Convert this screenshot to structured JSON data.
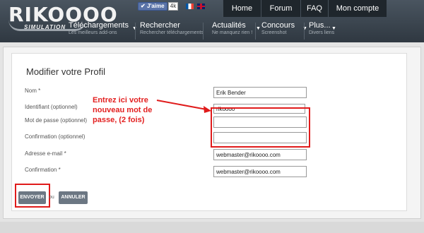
{
  "header": {
    "logo_text": "RIKOOOO",
    "logo_sub": "SIMULATION",
    "like_label": "J'aime",
    "like_count": "4k",
    "top_nav": [
      "Home",
      "Forum",
      "FAQ",
      "Mon compte"
    ],
    "main_nav": [
      {
        "title": "Téléchargements",
        "sub": "Les meilleurs add-ons"
      },
      {
        "title": "Rechercher",
        "sub": "Rechercher téléchargements"
      },
      {
        "title": "Actualités",
        "sub": "Ne manquez rien !"
      },
      {
        "title": "Concours",
        "sub": "Screenshot"
      },
      {
        "title": "Plus...",
        "sub": "Divers liens"
      }
    ]
  },
  "form": {
    "title": "Modifier votre Profil",
    "labels": {
      "name": "Nom *",
      "identifier": "Identifiant (optionnel)",
      "password": "Mot de passe (optionnel)",
      "confirm_password": "Confirmation (optionnel)",
      "email": "Adresse e-mail *",
      "confirm_email": "Confirmation *"
    },
    "values": {
      "name": "Erik Bender",
      "identifier": "rikoooo",
      "password": "",
      "confirm_password": "",
      "email": "webmaster@rikoooo.com",
      "confirm_email": "webmaster@rikoooo.com"
    },
    "submit_label": "ENVOYER",
    "or_label": "ou",
    "cancel_label": "ANNULER"
  },
  "annotation": {
    "text": "Entrez ici votre nouveau mot de passe, (2 fois)",
    "color": "#e32020"
  },
  "colors": {
    "header_bg": "#2f3841",
    "button_bg": "#6c7783",
    "highlight": "#e01b1b"
  }
}
